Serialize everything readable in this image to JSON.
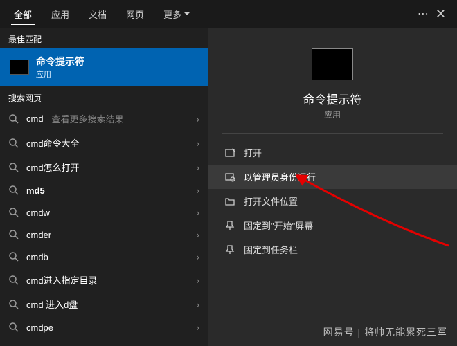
{
  "tabs": {
    "all": "全部",
    "apps": "应用",
    "docs": "文档",
    "web": "网页",
    "more": "更多"
  },
  "left": {
    "best_match_label": "最佳匹配",
    "match": {
      "title": "命令提示符",
      "subtitle": "应用"
    },
    "search_label": "搜索网页",
    "items": [
      {
        "term": "cmd",
        "hint": " - 查看更多搜索结果"
      },
      {
        "term": "cmd命令大全",
        "hint": ""
      },
      {
        "term": "cmd怎么打开",
        "hint": ""
      },
      {
        "term": "md5",
        "hint": "",
        "bold": true
      },
      {
        "term": "cmdw",
        "hint": ""
      },
      {
        "term": "cmder",
        "hint": ""
      },
      {
        "term": "cmdb",
        "hint": ""
      },
      {
        "term": "cmd进入指定目录",
        "hint": ""
      },
      {
        "term": "cmd 进入d盘",
        "hint": ""
      },
      {
        "term": "cmdpe",
        "hint": ""
      }
    ]
  },
  "right": {
    "title": "命令提示符",
    "subtitle": "应用",
    "actions": [
      {
        "label": "打开",
        "icon": "open"
      },
      {
        "label": "以管理员身份运行",
        "icon": "admin",
        "highlight": true
      },
      {
        "label": "打开文件位置",
        "icon": "folder"
      },
      {
        "label": "固定到\"开始\"屏幕",
        "icon": "pin-start"
      },
      {
        "label": "固定到任务栏",
        "icon": "pin-taskbar"
      }
    ]
  },
  "watermark": "网易号 | 将帅无能累死三军"
}
